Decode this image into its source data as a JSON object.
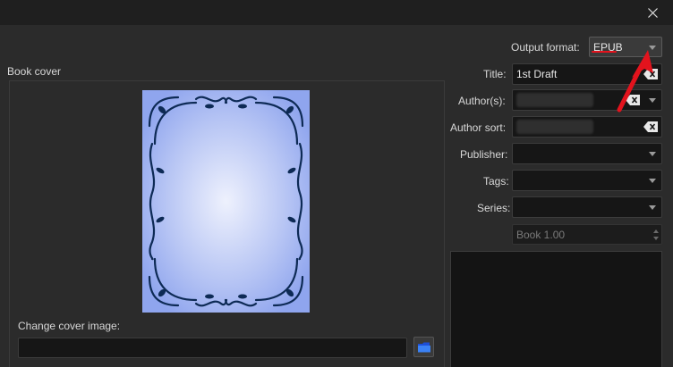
{
  "dialog": {
    "close_icon": "close-icon"
  },
  "output_format": {
    "label": "Output format:",
    "value": "EPUB"
  },
  "book_cover": {
    "group_label": "Book cover",
    "change_label": "Change cover image:",
    "path_value": "",
    "browse_icon": "folder-icon"
  },
  "metadata": {
    "title": {
      "label": "Title:",
      "value": "1st Draft"
    },
    "authors": {
      "label": "Author(s):",
      "value": ""
    },
    "author_sort": {
      "label": "Author sort:",
      "value": ""
    },
    "publisher": {
      "label": "Publisher:",
      "value": ""
    },
    "tags": {
      "label": "Tags:",
      "value": ""
    },
    "series": {
      "label": "Series:",
      "value": ""
    },
    "series_index": {
      "value": "Book 1.00"
    }
  },
  "colors": {
    "annotation_red": "#e3131d",
    "cover_blue": "#8fa5ee",
    "ornament": "#0d2a55"
  }
}
